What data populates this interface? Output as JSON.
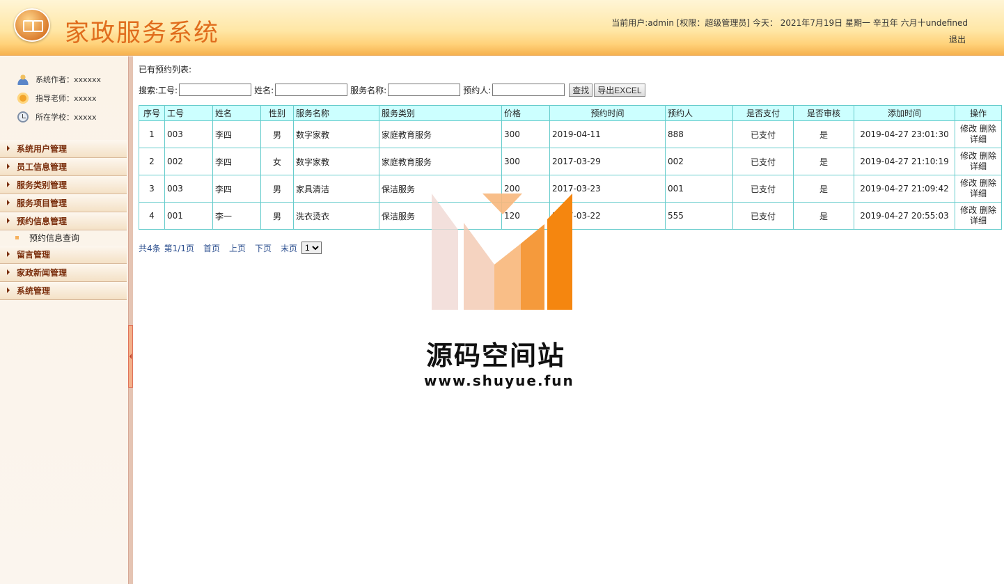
{
  "header": {
    "title": "家政服务系统",
    "user_info": "当前用户:admin [权限：超级管理员] 今天：  2021年7月19日 星期一 辛丑年 六月十undefined",
    "logout": "退出"
  },
  "sidebar": {
    "info": {
      "author": "系统作者：xxxxxx",
      "teacher": "指导老师：xxxxx",
      "school": "所在学校：xxxxx"
    },
    "menu": [
      "系统用户管理",
      "员工信息管理",
      "服务类别管理",
      "服务项目管理",
      "预约信息管理",
      "留言管理",
      "家政新闻管理",
      "系统管理"
    ],
    "submenu": "预约信息查询"
  },
  "main": {
    "list_title": "已有预约列表:",
    "search": {
      "prefix": "搜索: ",
      "emp_no_label": "工号:",
      "name_label": "姓名:",
      "service_name_label": "服务名称:",
      "booker_label": "预约人:",
      "find_button": "查找",
      "export_button": "导出EXCEL"
    },
    "table": {
      "headers": [
        "序号",
        "工号",
        "姓名",
        "性别",
        "服务名称",
        "服务类别",
        "价格",
        "预约时间",
        "预约人",
        "是否支付",
        "是否审核",
        "添加时间",
        "操作"
      ],
      "rows": [
        [
          "1",
          "003",
          "李四",
          "男",
          "数字家教",
          "家庭教育服务",
          "300",
          "2019-04-11",
          "888",
          "已支付",
          "是",
          "2019-04-27 23:01:30"
        ],
        [
          "2",
          "002",
          "李四",
          "女",
          "数字家教",
          "家庭教育服务",
          "300",
          "2017-03-29",
          "002",
          "已支付",
          "是",
          "2019-04-27 21:10:19"
        ],
        [
          "3",
          "003",
          "李四",
          "男",
          "家具清洁",
          "保洁服务",
          "200",
          "2017-03-23",
          "001",
          "已支付",
          "是",
          "2019-04-27 21:09:42"
        ],
        [
          "4",
          "001",
          "李一",
          "男",
          "洗衣烫衣",
          "保洁服务",
          "120",
          "2017-03-22",
          "555",
          "已支付",
          "是",
          "2019-04-27 20:55:03"
        ]
      ],
      "ops": {
        "edit": "修改",
        "delete": "删除",
        "detail": "详细"
      }
    },
    "pager": {
      "total": "共4条",
      "page": "第1/1页",
      "first": "首页",
      "prev": "上页",
      "next": "下页",
      "last": "末页",
      "selected": "1"
    }
  },
  "watermark": {
    "name": "源码空间站",
    "url": "www.shuyue.fun"
  }
}
